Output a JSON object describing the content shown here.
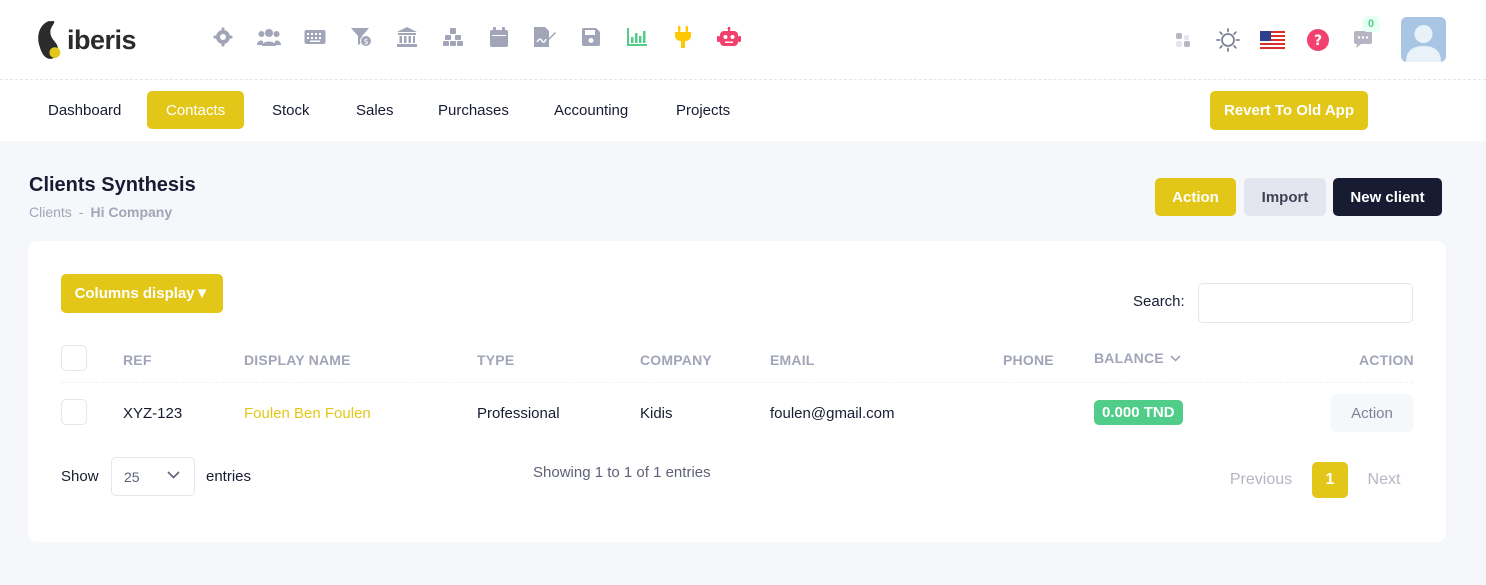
{
  "brand": {
    "name": "iberis"
  },
  "toolbar": {
    "icons": [
      "gear-icon",
      "users-icon",
      "keyboard-icon",
      "filter-dollar-icon",
      "bank-icon",
      "boxes-icon",
      "calendar-icon",
      "file-signature-icon",
      "save-icon",
      "chart-icon",
      "plug-icon",
      "robot-icon"
    ]
  },
  "header": {
    "notifications_count": "0"
  },
  "menu": {
    "items": [
      "Dashboard",
      "Contacts",
      "Stock",
      "Sales",
      "Purchases",
      "Accounting",
      "Projects"
    ],
    "active": "Contacts",
    "revert_label": "Revert To Old App"
  },
  "page": {
    "title": "Clients Synthesis",
    "breadcrumb": [
      "Clients",
      "-",
      "Hi Company"
    ],
    "action_label": "Action",
    "import_label": "Import",
    "new_client_label": "New client"
  },
  "table": {
    "columns_display_label": "Columns display▼",
    "search_label": "Search:",
    "search_value": "",
    "headers": [
      "REF",
      "DISPLAY NAME",
      "TYPE",
      "COMPANY",
      "EMAIL",
      "PHONE",
      "BALANCE",
      "ACTION"
    ],
    "rows": [
      {
        "ref": "XYZ-123",
        "display_name": "Foulen Ben Foulen",
        "type": "Professional",
        "company": "Kidis",
        "email": "foulen@gmail.com",
        "phone": "",
        "balance": "0.000 TND",
        "action": "Action"
      }
    ],
    "show_label": "Show",
    "page_length": "25",
    "entries_label": "entries",
    "info": "Showing 1 to 1 of 1 entries",
    "pagination": {
      "previous": "Previous",
      "current": "1",
      "next": "Next"
    }
  },
  "colors": {
    "accent": "#e2c719",
    "dark": "#181c32",
    "success": "#50cd89",
    "danger": "#f1416c"
  }
}
